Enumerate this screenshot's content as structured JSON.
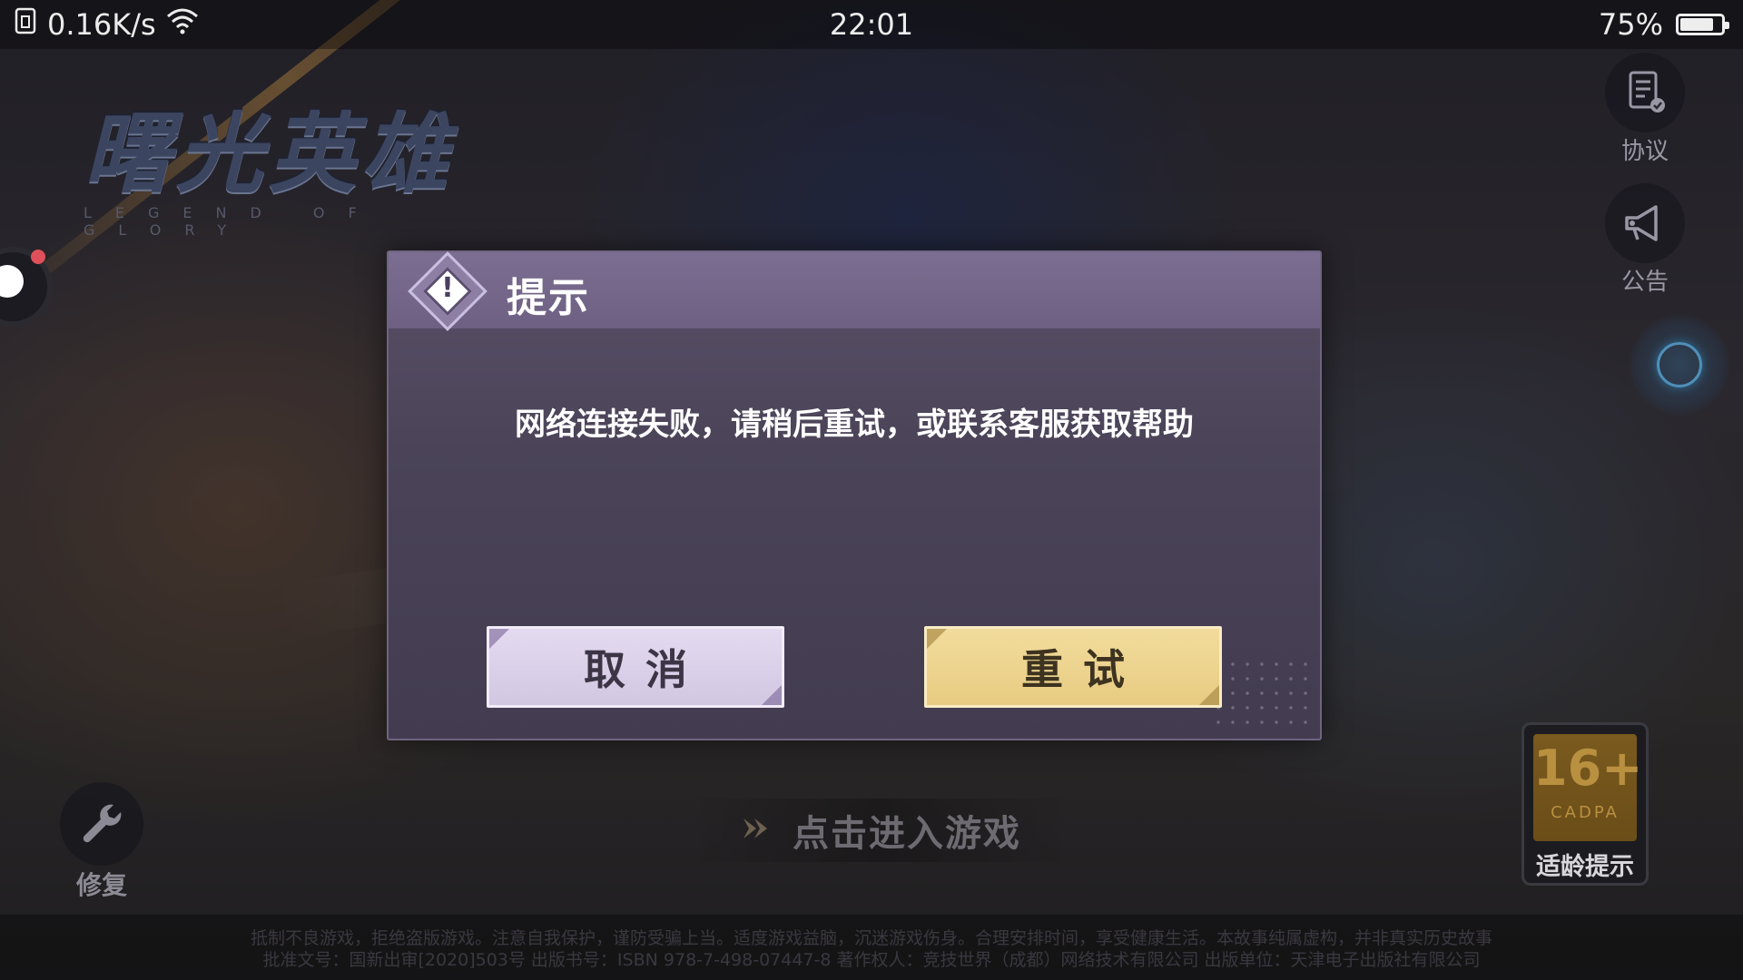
{
  "status_bar": {
    "net_speed": "0.16K/s",
    "time": "22:01",
    "battery_percent": "75%",
    "battery_level": 0.75
  },
  "logo": {
    "title": "曙光英雄",
    "subtitle": "LEGEND OF GLORY"
  },
  "side_buttons": {
    "agreement_label": "协议",
    "announcement_label": "公告"
  },
  "repair_label": "修复",
  "enter_game_label": "点击进入游戏",
  "age_badge": {
    "rating": "16+",
    "org": "CADPA",
    "label": "适龄提示"
  },
  "footer": {
    "line1": "抵制不良游戏，拒绝盗版游戏。注意自我保护，谨防受骗上当。适度游戏益脑，沉迷游戏伤身。合理安排时间，享受健康生活。本故事纯属虚构，并非真实历史故事",
    "line2": "批准文号：国新出审[2020]503号 出版书号：ISBN 978-7-498-07447-8 著作权人：竞技世界（成都）网络技术有限公司 出版单位：天津电子出版社有限公司"
  },
  "dialog": {
    "title": "提示",
    "message": "网络连接失败，请稍后重试，或联系客服获取帮助",
    "cancel_label": "取消",
    "retry_label": "重试",
    "icon": "warning-icon"
  },
  "colors": {
    "dialog_header": "#7c6e92",
    "cancel_button": "#e4daf0",
    "retry_button": "#f2dc9c"
  }
}
